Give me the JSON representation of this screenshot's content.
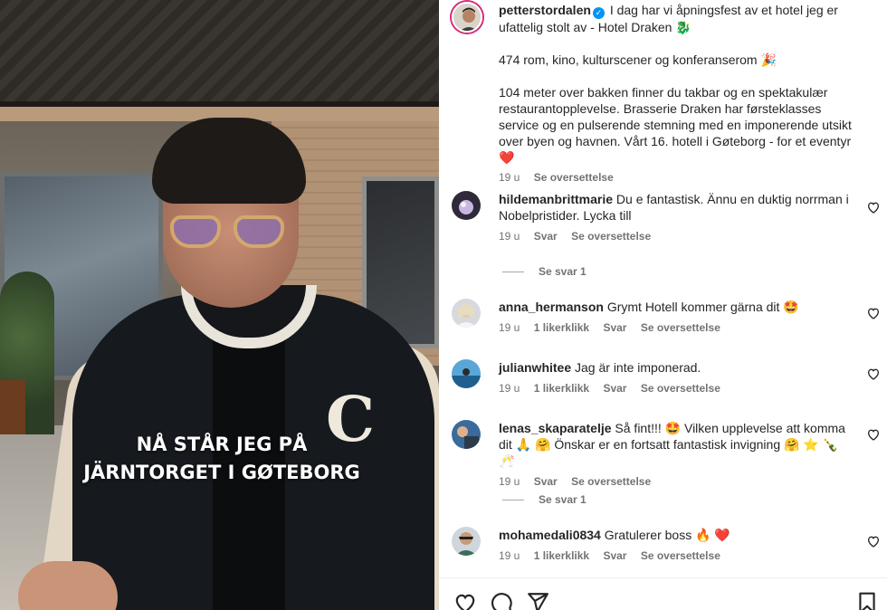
{
  "post": {
    "author": "petterstordalen",
    "caption_p1": "I dag har vi åpningsfest av et hotel jeg er ufattelig stolt av - Hotel Draken 🐉",
    "caption_p2": "474 rom, kino, kulturscener og konferanserom 🎉",
    "caption_p3": "104 meter over bakken finner du takbar og en spektakulær restaurantopplevelse. Brasserie Draken har førsteklasses service og en pulserende stemning med en imponerende utsikt over byen og havnen. Vårt 16. hotell i Gøteborg - for et eventyr ❤️",
    "time": "19 u",
    "translate": "Se oversettelse"
  },
  "video": {
    "overlay_line1": "NÅ STÅR JEG PÅ",
    "overlay_line2": "JÄRNTORGET I GØTEBORG"
  },
  "comments": [
    {
      "username": "hildemanbrittmarie",
      "text": "Du e fantastisk. Ännu en duktig norrman i Nobelpristider. Lycka till",
      "time": "19 u",
      "likes": "",
      "reply": "Svar",
      "translate": "Se oversettelse",
      "view_replies": "Se svar 1"
    },
    {
      "username": "anna_hermanson",
      "text": "Grymt Hotell kommer gärna dit 🤩",
      "time": "19 u",
      "likes": "1 likerklikk",
      "reply": "Svar",
      "translate": "Se oversettelse"
    },
    {
      "username": "julianwhitee",
      "text": "Jag är inte imponerad.",
      "time": "19 u",
      "likes": "1 likerklikk",
      "reply": "Svar",
      "translate": "Se oversettelse"
    },
    {
      "username": "lenas_skaparatelje",
      "text": "Så fint!!! 🤩 Vilken upplevelse att komma dit 🙏 🤗 Önskar er en fortsatt fantastisk invigning 🤗 ⭐ 🍾 🥂",
      "time": "19 u",
      "likes": "",
      "reply": "Svar",
      "translate": "Se oversettelse",
      "view_replies": "Se svar 1"
    },
    {
      "username": "mohamedali0834",
      "text": "Gratulerer boss 🔥 ❤️",
      "time": "19 u",
      "likes": "1 likerklikk",
      "reply": "Svar",
      "translate": "Se oversettelse"
    }
  ],
  "icons": {
    "like": "heart-icon",
    "comment": "comment-icon",
    "share": "share-icon",
    "save": "bookmark-icon"
  },
  "colors": {
    "accent": "#0095f6",
    "muted": "#737373",
    "text": "#262626"
  }
}
